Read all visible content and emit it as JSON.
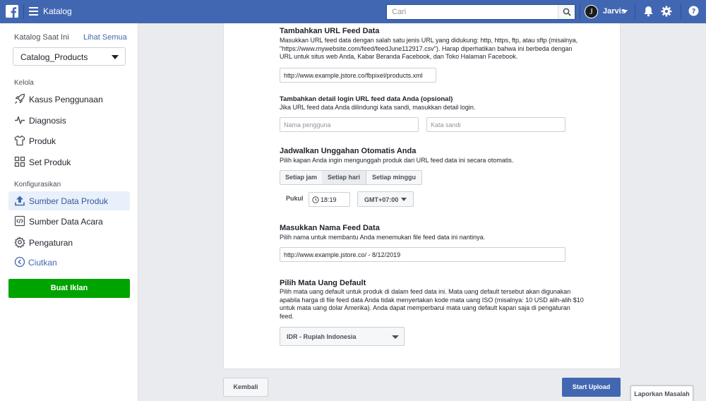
{
  "topbar": {
    "app_title": "Katalog",
    "search_placeholder": "Cari",
    "user_name": "Jarvis",
    "avatar_letter": "J"
  },
  "sidebar": {
    "catalog_label": "Katalog Saat Ini",
    "see_all": "Lihat Semua",
    "catalog_selected": "Catalog_Products",
    "section_manage": "Kelola",
    "manage_items": [
      {
        "label": "Kasus Penggunaan",
        "icon": "rocket-icon"
      },
      {
        "label": "Diagnosis",
        "icon": "pulse-icon"
      },
      {
        "label": "Produk",
        "icon": "shirt-icon"
      },
      {
        "label": "Set Produk",
        "icon": "grid-icon"
      }
    ],
    "section_config": "Konfigurasikan",
    "config_items": [
      {
        "label": "Sumber Data Produk",
        "icon": "upload-icon",
        "active": true
      },
      {
        "label": "Sumber Data Acara",
        "icon": "code-icon"
      },
      {
        "label": "Pengaturan",
        "icon": "gear-icon"
      }
    ],
    "collapse": "Ciutkan",
    "cta": "Buat Iklan"
  },
  "form": {
    "url_section": {
      "title": "Tambahkan URL Feed Data",
      "desc": "Masukkan URL feed data dengan salah satu jenis URL yang didukung: http, https, ftp, atau sftp (misalnya, \"https://www.mywebsite.com/feed/feedJune112917.csv\"). Harap diperhatikan bahwa ini berbeda dengan URL untuk situs web Anda, Kabar Beranda Facebook, dan Toko Halaman Facebook.",
      "value": "http://www.example.jstore.co/fbpixel/products.xml"
    },
    "login_section": {
      "title": "Tambahkan detail login URL feed data Anda (opsional)",
      "desc": "Jika URL feed data Anda dilindungi kata sandi, masukkan detail login.",
      "username_placeholder": "Nama pengguna",
      "password_placeholder": "Kata sandi"
    },
    "schedule_section": {
      "title": "Jadwalkan Unggahan Otomatis Anda",
      "desc": "Pilih kapan Anda ingin mengunggah produk dari URL feed data ini secara otomatis.",
      "options": [
        "Setiap jam",
        "Setiap hari",
        "Setiap minggu"
      ],
      "selected": "Setiap hari",
      "time_label": "Pukul",
      "time_value": "18:19",
      "timezone": "GMT+07:00"
    },
    "name_section": {
      "title": "Masukkan Nama Feed Data",
      "desc": "Pilih nama untuk membantu Anda menemukan file feed data ini nantinya.",
      "value": "http://www.example.jstore.co/ - 8/12/2019"
    },
    "currency_section": {
      "title": "Pilih Mata Uang Default",
      "desc": "Pilih mata uang default untuk produk di dalam feed data ini. Mata uang default tersebut akan digunakan apabila harga di file feed data Anda tidak menyertakan kode mata uang ISO (misalnya: 10 USD alih-alih $10 untuk mata uang dolar Amerika). Anda dapat memperbarui mata uang default kapan saja di pengaturan feed.",
      "selected": "IDR - Rupiah Indonesia"
    }
  },
  "footer": {
    "back": "Kembali",
    "upload": "Start Upload",
    "report": "Laporkan Masalah"
  },
  "colors": {
    "brand": "#4267b2",
    "cta_green": "#00a400",
    "active_bg": "#e7f0fb"
  }
}
